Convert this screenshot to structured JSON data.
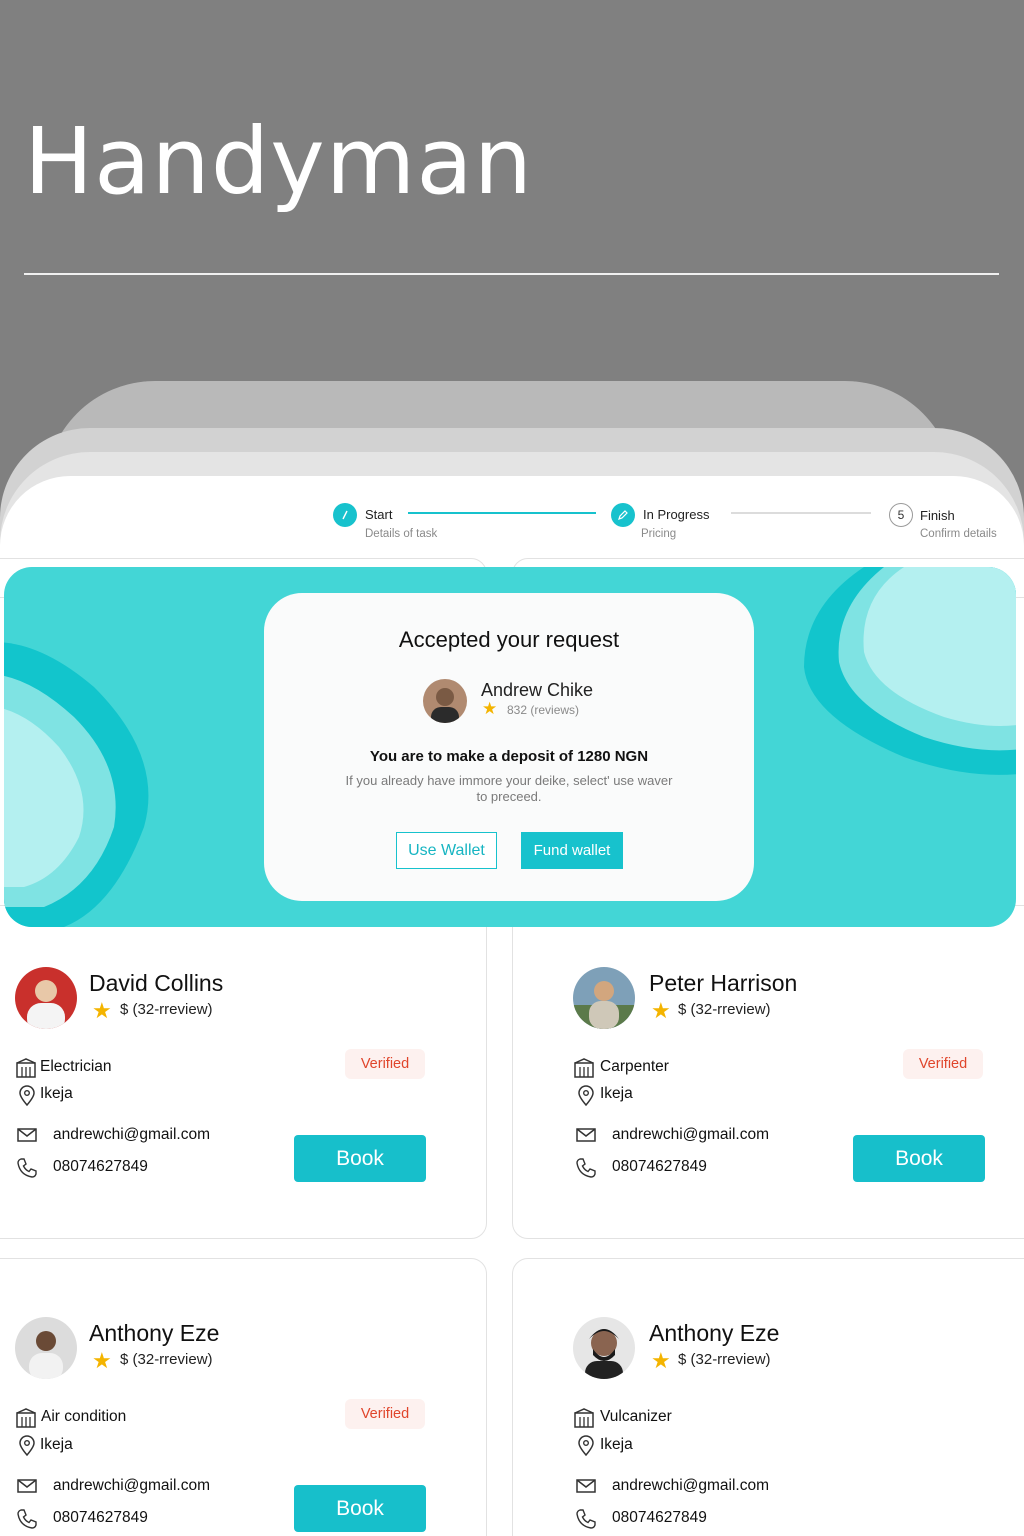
{
  "hero": {
    "title": "Handyman"
  },
  "stepper": {
    "steps": [
      {
        "label": "Start",
        "sub": "Details of task",
        "icon": "/"
      },
      {
        "label": "In Progress",
        "sub": "Pricing",
        "icon": "✎"
      },
      {
        "label": "Finish",
        "sub": "Confirm details",
        "icon": "5"
      }
    ]
  },
  "modal": {
    "title": "Accepted your request",
    "provider_name": "Andrew Chike",
    "rating_text": "832 (reviews)",
    "deposit_text": "You are to make a deposit of 1280 NGN",
    "note": "If you already have immore your deike, select' use waver to preceed.",
    "use_wallet": "Use Wallet",
    "fund_wallet": "Fund wallet"
  },
  "cards": [
    {
      "name": "David Collins",
      "review": "$ (32-rreview)",
      "trade": "Electrician",
      "location": "Ikeja",
      "email": "andrewchi@gmail.com",
      "phone": "08074627849",
      "badge": "Verified",
      "book": "Book"
    },
    {
      "name": "Peter Harrison",
      "review": "$ (32-rreview)",
      "trade": "Carpenter",
      "location": "Ikeja",
      "email": "andrewchi@gmail.com",
      "phone": "08074627849",
      "badge": "Verified",
      "book": "Book"
    },
    {
      "name": "Anthony Eze",
      "review": "$ (32-rreview)",
      "trade": "Air condition",
      "location": "Ikeja",
      "email": "andrewchi@gmail.com",
      "phone": "08074627849",
      "badge": "Verified",
      "book": "Book"
    },
    {
      "name": "Anthony Eze",
      "review": "$ (32-rreview)",
      "trade": "Vulcanizer",
      "location": "Ikeja",
      "email": "andrewchi@gmail.com",
      "phone": "08074627849"
    }
  ],
  "colors": {
    "accent": "#17c2cd",
    "banner": "#43d6d6",
    "verified_text": "#e0452b",
    "star": "#f4b400",
    "backdrop": "#808080"
  },
  "icons": [
    "star-icon",
    "building-icon",
    "location-pin-icon",
    "mail-icon",
    "phone-icon",
    "check-icon",
    "pencil-icon"
  ]
}
